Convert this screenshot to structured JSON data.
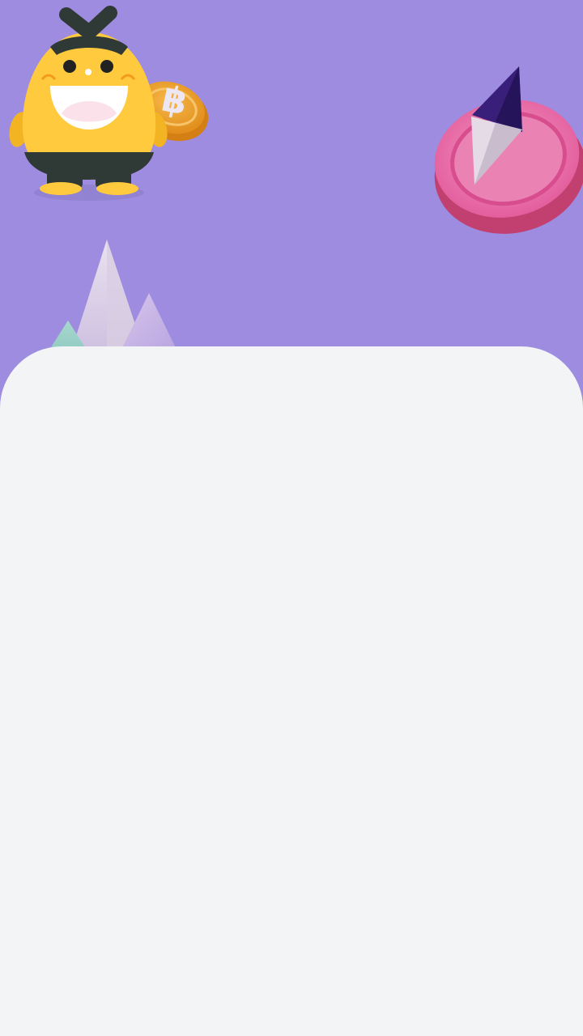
{
  "screen": {
    "background_color": "#9d8ce0",
    "sheet_color": "#f3f4f6"
  },
  "illustration": {
    "coin_symbol": "฿",
    "coin_icon": "bitcoin-coin-icon",
    "eth_icon": "ethereum-token-icon",
    "mountains_icon": "crystal-mountains-icon",
    "mascot_icon": "yellow-mascot-icon",
    "mascot_color": "#ffc93c",
    "coin_color": "#f2a52e",
    "token_color": "#e96fa6"
  }
}
